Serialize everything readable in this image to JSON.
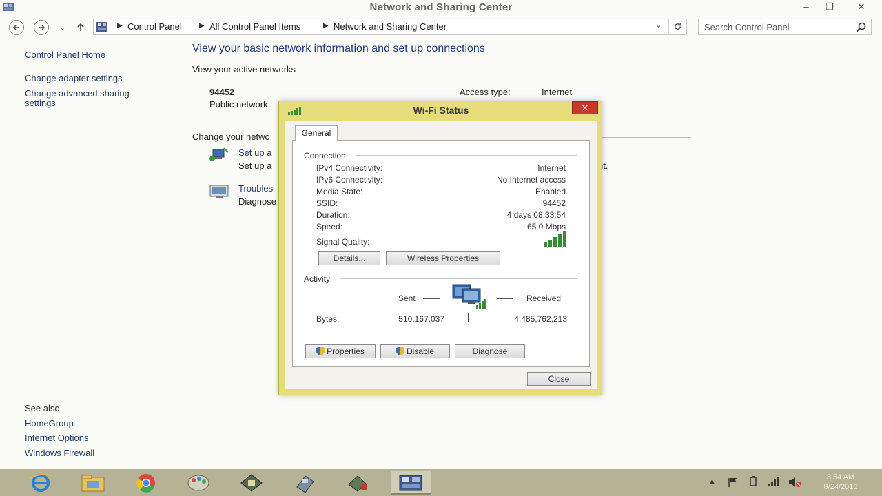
{
  "window": {
    "title": "Network and Sharing Center",
    "controls": [
      "–",
      "❐",
      "✕"
    ]
  },
  "navigation": {
    "breadcrumb": [
      "Control Panel",
      "All Control Panel Items",
      "Network and Sharing Center"
    ],
    "search_placeholder": "Search Control Panel"
  },
  "sidebar": {
    "home": "Control Panel Home",
    "links": [
      "Change adapter settings",
      "Change advanced sharing",
      "settings"
    ],
    "see_also_label": "See also",
    "see_also": [
      "HomeGroup",
      "Internet Options",
      "Windows Firewall"
    ]
  },
  "main": {
    "heading": "View your basic network information and set up connections",
    "active_networks_title": "View your active networks",
    "network_name": "94452",
    "network_type": "Public network",
    "access_type_label": "Access type:",
    "access_type_value": "Internet",
    "change_settings_title": "Change your netwo",
    "tasks": [
      {
        "link": "Set up a",
        "desc": "Set up a"
      },
      {
        "link": "Troubles",
        "desc": "Diagnose"
      }
    ],
    "overflow_text": "nt."
  },
  "dialog": {
    "title": "Wi-Fi Status",
    "close_glyph": "✕",
    "tab": "General",
    "connection_title": "Connection",
    "fields": [
      {
        "label": "IPv4 Connectivity:",
        "value": "Internet"
      },
      {
        "label": "IPv6 Connectivity:",
        "value": "No Internet access"
      },
      {
        "label": "Media State:",
        "value": "Enabled"
      },
      {
        "label": "SSID:",
        "value": "94452"
      },
      {
        "label": "Duration:",
        "value": "4 days 08:33:54"
      },
      {
        "label": "Speed:",
        "value": "65.0 Mbps"
      }
    ],
    "signal_quality_label": "Signal Quality:",
    "signal_bars": 5,
    "details_button": "Details...",
    "wireless_properties_button": "Wireless Properties",
    "activity_title": "Activity",
    "sent_label": "Sent",
    "received_label": "Received",
    "bytes_label": "Bytes:",
    "bytes_sent": "510,167,037",
    "bytes_received": "4,485,762,213",
    "properties_button": "Properties",
    "disable_button": "Disable",
    "diagnose_button": "Diagnose",
    "close_button": "Close"
  },
  "taskbar": {
    "apps": [
      "internet-explorer-icon",
      "file-explorer-icon",
      "chrome-icon",
      "paint-icon",
      "app-icon-1",
      "app-icon-2",
      "app-icon-3",
      "control-panel-icon"
    ],
    "clock_time": "3:54 AM",
    "clock_date": "8/24/2015"
  },
  "colors": {
    "link": "#1f3b66",
    "heading": "#1e3a78",
    "dialog_frame": "#e6dc7a",
    "close_red": "#c7392a",
    "taskbar": "#b5b296",
    "signal_green": "#3a8a3a"
  }
}
